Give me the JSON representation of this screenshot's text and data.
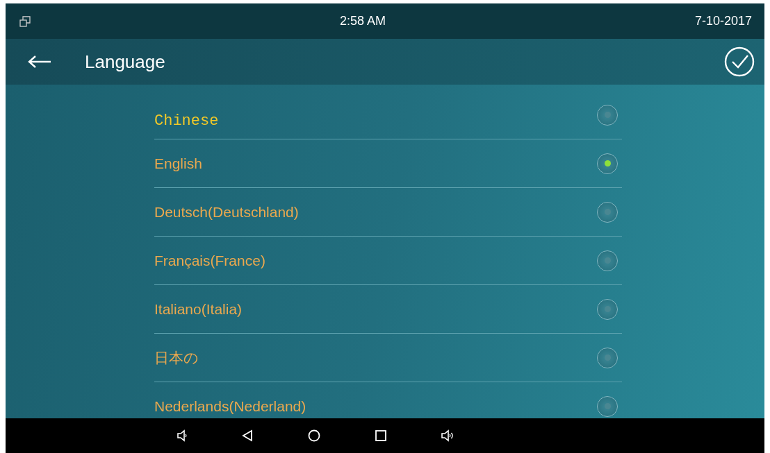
{
  "status_bar": {
    "time": "2:58 AM",
    "date": "7-10-2017"
  },
  "title_bar": {
    "title": "Language"
  },
  "languages": [
    {
      "label": "Chinese",
      "kind": "monospace",
      "selected": false
    },
    {
      "label": "English",
      "kind": "regular",
      "selected": true
    },
    {
      "label": "Deutsch(Deutschland)",
      "kind": "regular",
      "selected": false
    },
    {
      "label": "Français(France)",
      "kind": "regular",
      "selected": false
    },
    {
      "label": "Italiano(Italia)",
      "kind": "regular",
      "selected": false
    },
    {
      "label": "日本の",
      "kind": "regular",
      "selected": false
    },
    {
      "label": "Nederlands(Nederland)",
      "kind": "regular",
      "selected": false
    }
  ]
}
